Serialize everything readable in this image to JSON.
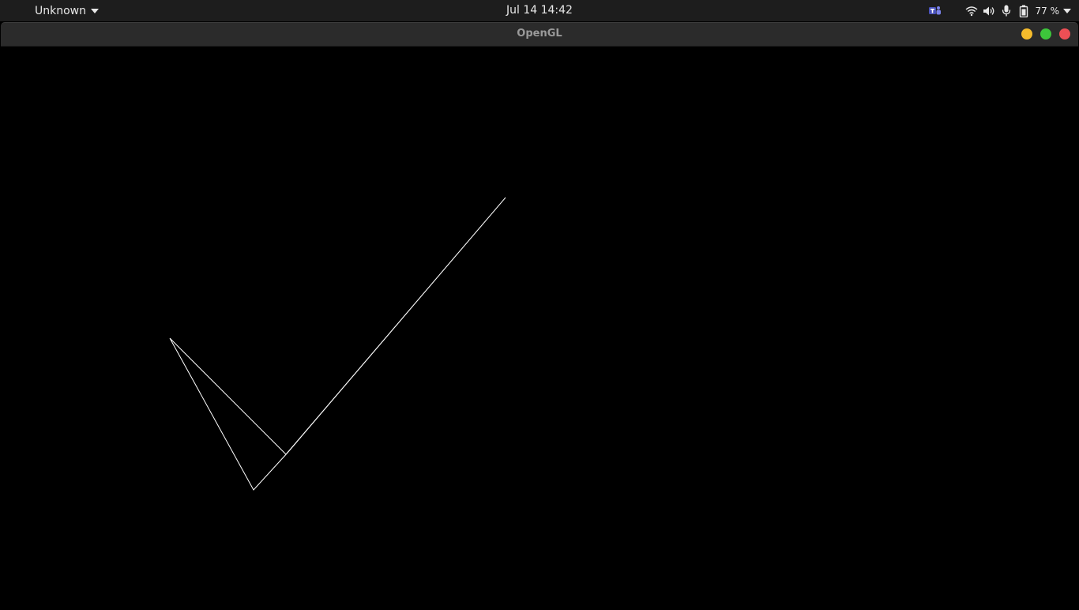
{
  "topbar": {
    "app_menu_label": "Unknown",
    "clock": "Jul 14  14:42",
    "battery_percent": "77 %",
    "icons": [
      "teams-icon",
      "wifi-icon",
      "volume-icon",
      "microphone-icon",
      "battery-icon",
      "chevron-down-icon"
    ]
  },
  "window": {
    "title": "OpenGL",
    "controls": [
      "minimize",
      "maximize",
      "close"
    ]
  },
  "colors": {
    "topbar_bg": "#1d1d1d",
    "titlebar_bg": "#2b2b2b",
    "canvas_bg": "#000000",
    "line_color": "#ffffff",
    "minimize": "#f6bc2c",
    "maximize": "#3dc63b",
    "close": "#ed4f55"
  }
}
